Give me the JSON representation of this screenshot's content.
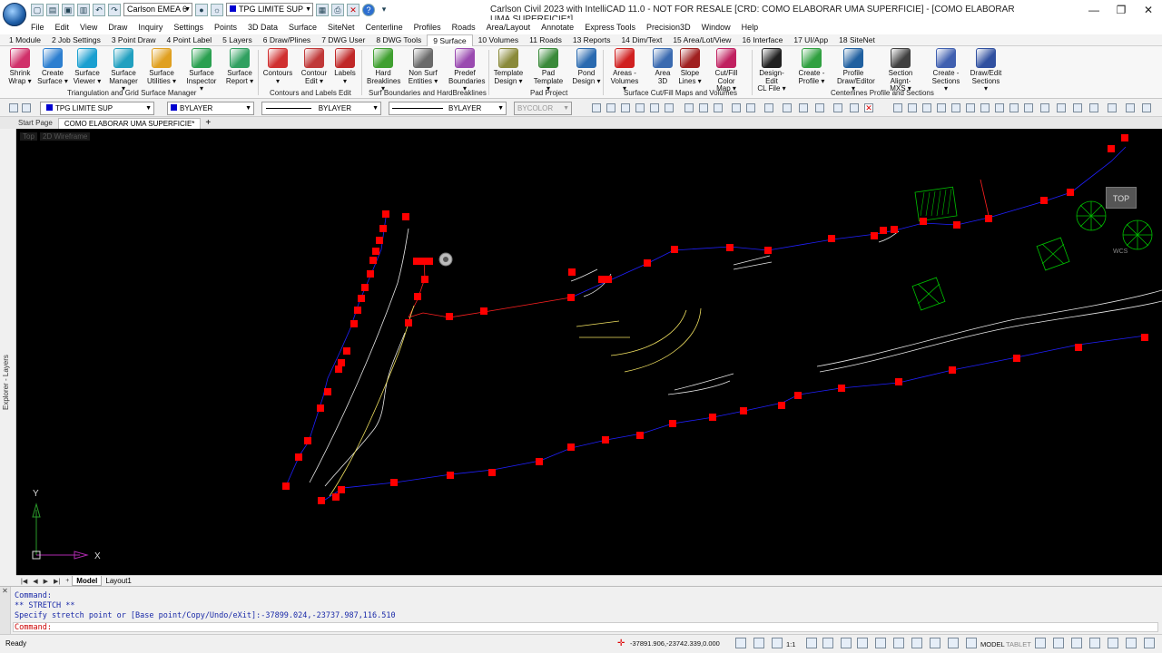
{
  "window": {
    "title": "Carlson Civil 2023 with IntelliCAD 11.0 - NOT FOR RESALE [CRD: COMO ELABORAR UMA SUPERFICIE] - [COMO ELABORAR UMA SUPERFICIE*]",
    "workspace_combo": "Carlson EMEA 6",
    "layer_combo": "TPG LIMITE SUP",
    "buttons": {
      "minimize": "—",
      "restore": "❐",
      "close": "✕"
    }
  },
  "menu": [
    "File",
    "Edit",
    "View",
    "Draw",
    "Inquiry",
    "Settings",
    "Points",
    "3D Data",
    "Surface",
    "SiteNet",
    "Centerline",
    "Profiles",
    "Roads",
    "Area/Layout",
    "Annotate",
    "Express Tools",
    "Precision3D",
    "Window",
    "Help"
  ],
  "ribbon_tabs": [
    "1 Module",
    "2 Job Settings",
    "3 Point Draw",
    "4 Point Label",
    "5 Layers",
    "6 Draw/Plines",
    "7 DWG User",
    "8 DWG Tools",
    "9 Surface",
    "10 Volumes",
    "11 Roads",
    "13 Reports",
    "14 Dim/Text",
    "15 Area/Lot/View",
    "16 Interface",
    "17 UI/App",
    "18 SiteNet"
  ],
  "active_ribbon_tab": "9 Surface",
  "ribbon_buttons": [
    {
      "l1": "Shrink",
      "l2": "Wrap ▾",
      "color": "#d0306a"
    },
    {
      "l1": "Create",
      "l2": "Surface ▾",
      "color": "#2d7fd0"
    },
    {
      "l1": "Surface",
      "l2": "Viewer ▾",
      "color": "#1a9fd0"
    },
    {
      "l1": "Surface",
      "l2": "Manager ▾",
      "color": "#21a0c0"
    },
    {
      "l1": "Surface",
      "l2": "Utilities ▾",
      "color": "#e0a020"
    },
    {
      "l1": "Surface",
      "l2": "Inspector ▾",
      "color": "#2aa050"
    },
    {
      "l1": "Surface",
      "l2": "Report ▾",
      "color": "#30a060"
    },
    {
      "l1": "Contours",
      "l2": "▾",
      "color": "#d03030"
    },
    {
      "l1": "Contour",
      "l2": "Edit ▾",
      "color": "#c03838"
    },
    {
      "l1": "Labels",
      "l2": "▾",
      "color": "#c02828"
    },
    {
      "l1": "Hard",
      "l2": "Breaklines ▾",
      "color": "#40a030"
    },
    {
      "l1": "Non Surf",
      "l2": "Entities ▾",
      "color": "#6a6a6a"
    },
    {
      "l1": "Predef",
      "l2": "Boundaries ▾",
      "color": "#9a4ab0"
    },
    {
      "l1": "Template",
      "l2": "Design ▾",
      "color": "#8a8a3a"
    },
    {
      "l1": "Pad",
      "l2": "Template ▾",
      "color": "#3a8a3a"
    },
    {
      "l1": "Pond",
      "l2": "Design ▾",
      "color": "#2a6ab0"
    },
    {
      "l1": "Areas -",
      "l2": "Volumes ▾",
      "color": "#d02020"
    },
    {
      "l1": "Area",
      "l2": "3D",
      "color": "#3a6ab0"
    },
    {
      "l1": "Slope",
      "l2": "Lines ▾",
      "color": "#a02020"
    },
    {
      "l1": "Cut/Fill",
      "l2": "Color Map ▾",
      "color": "#c02060"
    },
    {
      "l1": "Design-Edit",
      "l2": "CL File ▾",
      "color": "#202020"
    },
    {
      "l1": "Create -",
      "l2": "Profile ▾",
      "color": "#30a040"
    },
    {
      "l1": "Profile",
      "l2": "Draw/Editor ▾",
      "color": "#2060a0"
    },
    {
      "l1": "Section",
      "l2": "Alignt-MXS ▾",
      "color": "#404040"
    },
    {
      "l1": "Create -",
      "l2": "Sections ▾",
      "color": "#4060b0"
    },
    {
      "l1": "Draw/Edit",
      "l2": "Sections ▾",
      "color": "#3050a0"
    }
  ],
  "ribbon_groups": [
    "Triangulation and Grid Surface Manager",
    "Contours and Labels Edit",
    "Surf Boundaries and HardBreaklines",
    "Pad Project",
    "Surface Cut/Fill Maps and Volumes",
    "Centerlines Profile and Sections"
  ],
  "properties_bar": {
    "layer": "TPG LIMITE SUP",
    "color": "BYLAYER",
    "linetype": "BYLAYER",
    "lineweight": "BYLAYER",
    "plotstyle": "BYCOLOR"
  },
  "doc_tabs": [
    "Start Page",
    "COMO ELABORAR UMA SUPERFICIE*"
  ],
  "active_doc_tab": "COMO ELABORAR UMA SUPERFICIE*",
  "left_panel_label": "Explorer - Layers",
  "viewport": {
    "view_label": "Top",
    "style_label": "2D Wireframe",
    "navcube_label": "TOP",
    "wcs_label": "WCS",
    "ucs_y": "Y",
    "ucs_x": "X"
  },
  "layout_tabs": [
    "Model",
    "Layout1"
  ],
  "active_layout_tab": "Model",
  "command_history": [
    {
      "text": "Command:",
      "style": "blue"
    },
    {
      "text": "** STRETCH **",
      "style": "blue"
    },
    {
      "text": "Specify stretch point or [Base point/Copy/Undo/eXit]:-37899.024,-23737.987,116.510",
      "style": "blue"
    }
  ],
  "command_prompt": "Command:",
  "status": {
    "ready": "Ready",
    "coords": "-37891.906,-23742.339,0.000",
    "scale": "1:1",
    "model": "MODEL",
    "tablet": "TABLET"
  },
  "colors": {
    "viewport_bg": "#000000",
    "boundary_marker": "#ff0000",
    "blue_line": "#2020ff",
    "contour_white": "#e6e6e6",
    "contour_yellow": "#f0e060",
    "tree_green": "#00c000"
  }
}
